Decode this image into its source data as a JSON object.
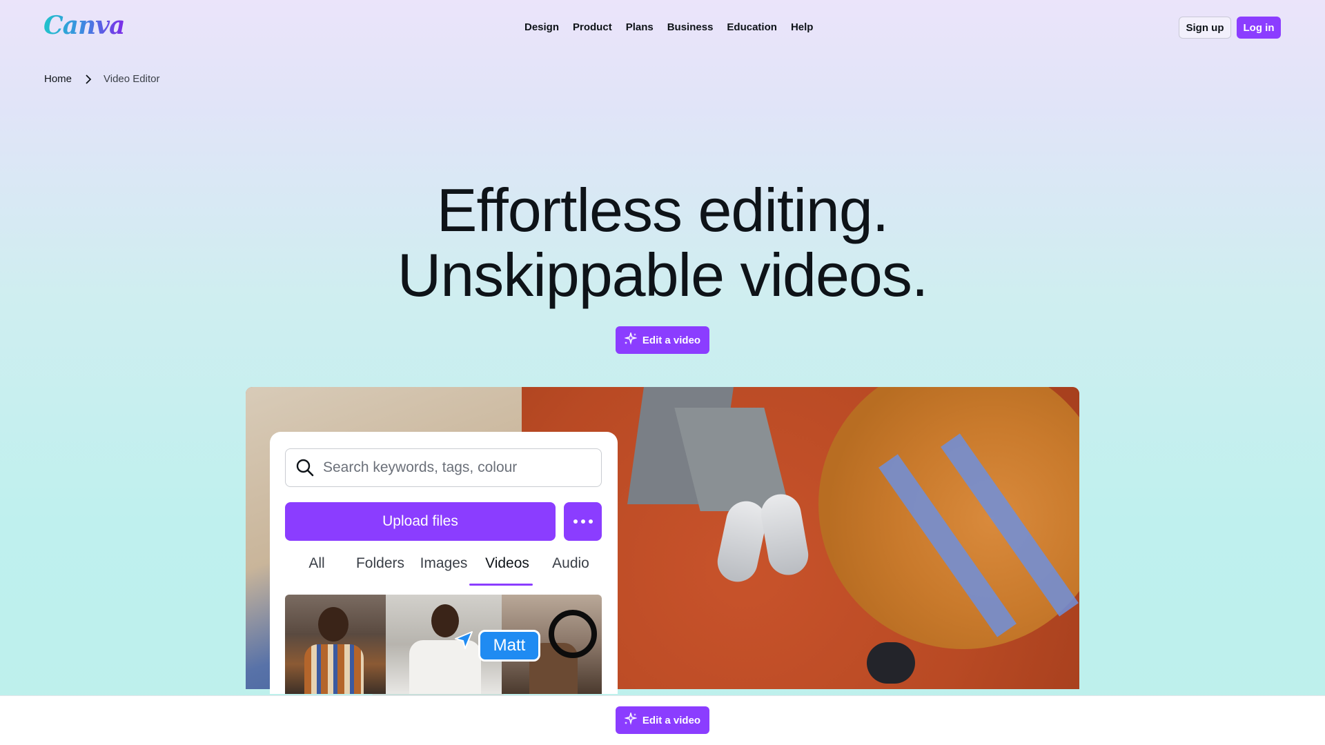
{
  "header": {
    "logo_text": "Canva",
    "nav": [
      {
        "label": "Design"
      },
      {
        "label": "Product"
      },
      {
        "label": "Plans"
      },
      {
        "label": "Business"
      },
      {
        "label": "Education"
      },
      {
        "label": "Help"
      }
    ],
    "signup_label": "Sign up",
    "login_label": "Log in"
  },
  "breadcrumb": {
    "home": "Home",
    "current": "Video Editor"
  },
  "hero": {
    "title_line1": "Effortless editing.",
    "title_line2": "Unskippable videos.",
    "cta_label": "Edit a video"
  },
  "panel": {
    "search_placeholder": "Search keywords, tags, colour",
    "upload_label": "Upload files",
    "tabs": [
      {
        "label": "All"
      },
      {
        "label": "Folders"
      },
      {
        "label": "Images"
      },
      {
        "label": "Videos",
        "active": true
      },
      {
        "label": "Audio"
      }
    ],
    "collaborator_name": "Matt"
  },
  "sticky_bar": {
    "cta_label": "Edit a video"
  },
  "colors": {
    "accent": "#8b3dff",
    "collaborator": "#1f8bf2",
    "text": "#0e1318"
  },
  "icons": {
    "breadcrumb_separator": "chevron-right-icon",
    "cta": "magic-sparkle-icon",
    "search": "search-icon",
    "more": "more-horizontal-icon",
    "cursor": "pointer-cursor-icon"
  }
}
